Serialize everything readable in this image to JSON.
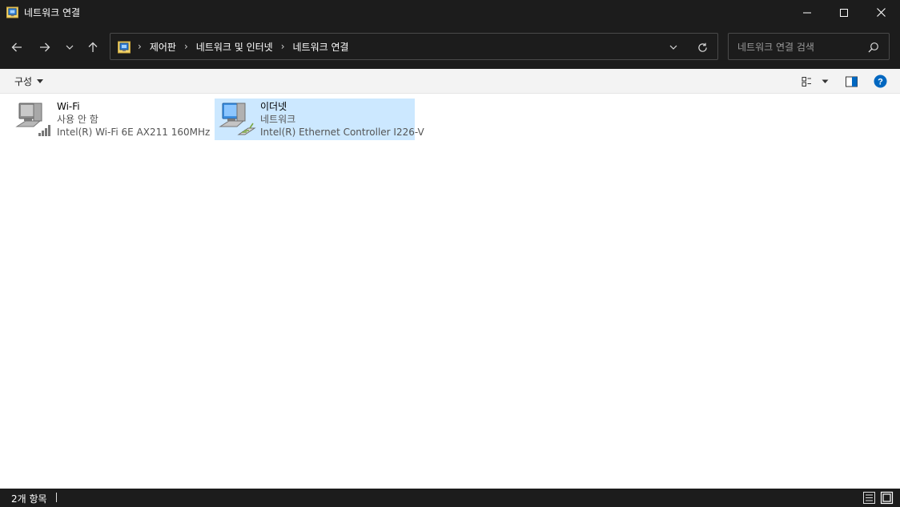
{
  "window": {
    "title": "네트워크 연결",
    "minimize_icon": "minimize-icon",
    "maximize_icon": "maximize-icon",
    "close_icon": "close-icon"
  },
  "navigation": {
    "back_icon": "arrow-left-icon",
    "forward_icon": "arrow-right-icon",
    "recent_icon": "chevron-down-icon",
    "up_icon": "arrow-up-icon"
  },
  "address": {
    "breadcrumbs": [
      "제어판",
      "네트워크 및 인터넷",
      "네트워크 연결"
    ],
    "dropdown_icon": "chevron-down-icon",
    "refresh_icon": "refresh-icon"
  },
  "search": {
    "placeholder": "네트워크 연결 검색"
  },
  "command_bar": {
    "organize_label": "구성"
  },
  "connections": [
    {
      "name": "Wi-Fi",
      "status": "사용 안 함",
      "device": "Intel(R) Wi-Fi 6E AX211 160MHz",
      "icon": "wifi-adapter-icon",
      "selected": false
    },
    {
      "name": "이더넷",
      "status": "네트워크",
      "device": "Intel(R) Ethernet Controller I226-V",
      "icon": "ethernet-adapter-icon",
      "selected": true
    }
  ],
  "status_bar": {
    "item_count": "2개 항목"
  },
  "colors": {
    "titlebar": "#1c1c1c",
    "selection": "#cce8ff",
    "help_blue": "#0067c0"
  }
}
